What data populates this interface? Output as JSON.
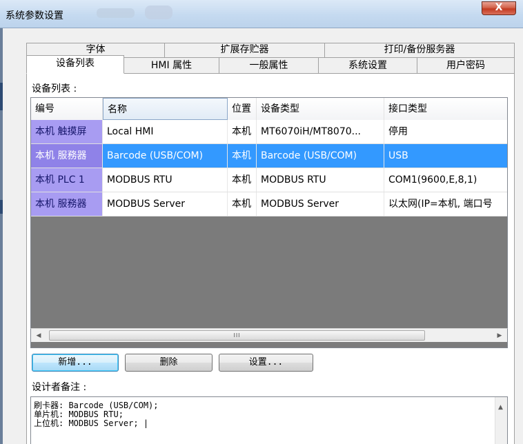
{
  "window": {
    "title": "系统参数设置",
    "close_label": "X"
  },
  "tabs": {
    "row1": [
      "字体",
      "扩展存贮器",
      "打印/备份服务器"
    ],
    "row2": [
      "设备列表",
      "HMI 属性",
      "一般属性",
      "系统设置",
      "用户密码"
    ],
    "active": "设备列表"
  },
  "device_list": {
    "label": "设备列表 :",
    "columns": [
      "编号",
      "名称",
      "位置",
      "设备类型",
      "接口类型"
    ],
    "sorted_column": "名称",
    "rows": [
      {
        "id": "本机 触摸屏",
        "name": "Local HMI",
        "location": "本机",
        "type": "MT6070iH/MT8070...",
        "interface": "停用",
        "selected": false
      },
      {
        "id": "本机 服務器",
        "name": "Barcode (USB/COM)",
        "location": "本机",
        "type": "Barcode (USB/COM)",
        "interface": "USB",
        "selected": true
      },
      {
        "id": "本机 PLC 1",
        "name": "MODBUS RTU",
        "location": "本机",
        "type": "MODBUS RTU",
        "interface": "COM1(9600,E,8,1)",
        "selected": false
      },
      {
        "id": "本机 服務器",
        "name": "MODBUS Server",
        "location": "本机",
        "type": "MODBUS Server",
        "interface": "以太网(IP=本机, 端口号",
        "selected": false
      }
    ],
    "scroll_thumb_glyph": "III",
    "scroll_left_glyph": "◀",
    "scroll_right_glyph": "▶"
  },
  "buttons": {
    "add": "新增...",
    "delete": "删除",
    "settings": "设置..."
  },
  "notes": {
    "label": "设计者备注 :",
    "lines": [
      "刷卡器: Barcode (USB/COM);",
      "单片机: MODBUS RTU;",
      "上位机: MODBUS Server; |"
    ],
    "scroll_up_glyph": "▲"
  },
  "colors": {
    "selection": "#3399ff",
    "id_cell": "#a89cf2",
    "empty_list_area": "#7b7b7b"
  }
}
